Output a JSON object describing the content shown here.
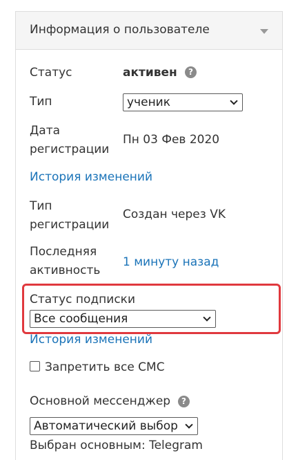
{
  "panel": {
    "title": "Информация о пользователе"
  },
  "fields": {
    "status_label": "Статус",
    "status_value": "активен",
    "type_label": "Тип",
    "type_value": "ученик",
    "reg_date_label_1": "Дата",
    "reg_date_label_2": "регистрации",
    "reg_date_value": "Пн 03 Фев 2020",
    "history_link": "История изменений",
    "reg_type_label_1": "Тип",
    "reg_type_label_2": "регистрации",
    "reg_type_value": "Создан через VK",
    "last_active_label_1": "Последняя",
    "last_active_label_2": "активность",
    "last_active_value": "1 минуту назад",
    "subscription_label": "Статус подписки",
    "subscription_value": "Все сообщения",
    "subscription_history_link": "История изменений",
    "sms_ban_label": "Запретить все СМС",
    "messenger_label": "Основной мессенджер",
    "messenger_value": "Автоматический выбор",
    "messenger_selected": "Выбран основным: Telegram"
  },
  "icons": {
    "help": "?"
  },
  "colors": {
    "link": "#1a73b8",
    "highlight": "#e0393e"
  }
}
